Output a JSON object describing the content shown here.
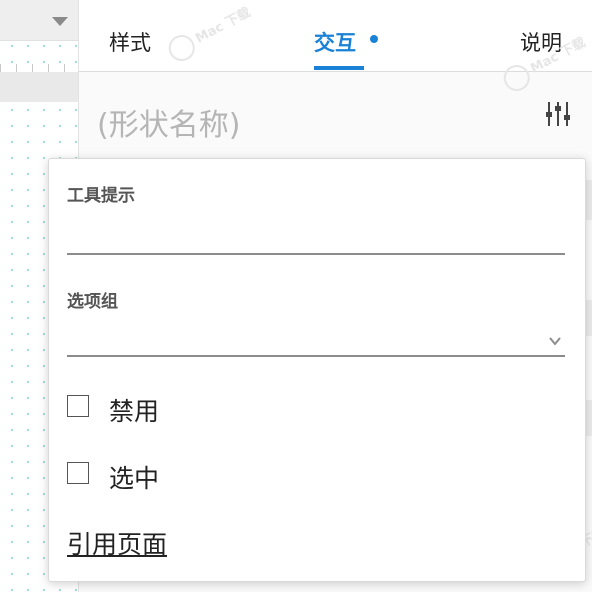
{
  "tabs": [
    {
      "label": "样式",
      "active": false
    },
    {
      "label": "交互",
      "active": true
    },
    {
      "label": "说明",
      "active": false
    }
  ],
  "shape": {
    "name_placeholder": "(形状名称)"
  },
  "popup": {
    "tooltip_label": "工具提示",
    "tooltip_value": "",
    "option_group_label": "选项组",
    "option_group_value": "",
    "checkboxes": [
      {
        "label": "禁用",
        "checked": false
      },
      {
        "label": "选中",
        "checked": false
      }
    ],
    "reference_page_link": "引用页面"
  },
  "watermark": {
    "text": "Mac 下载"
  },
  "colors": {
    "accent": "#1a82d6",
    "canvas_dot": "#9fd9cf"
  },
  "icons": [
    "chevron-down-icon",
    "sliders-icon",
    "caret-down-icon"
  ]
}
